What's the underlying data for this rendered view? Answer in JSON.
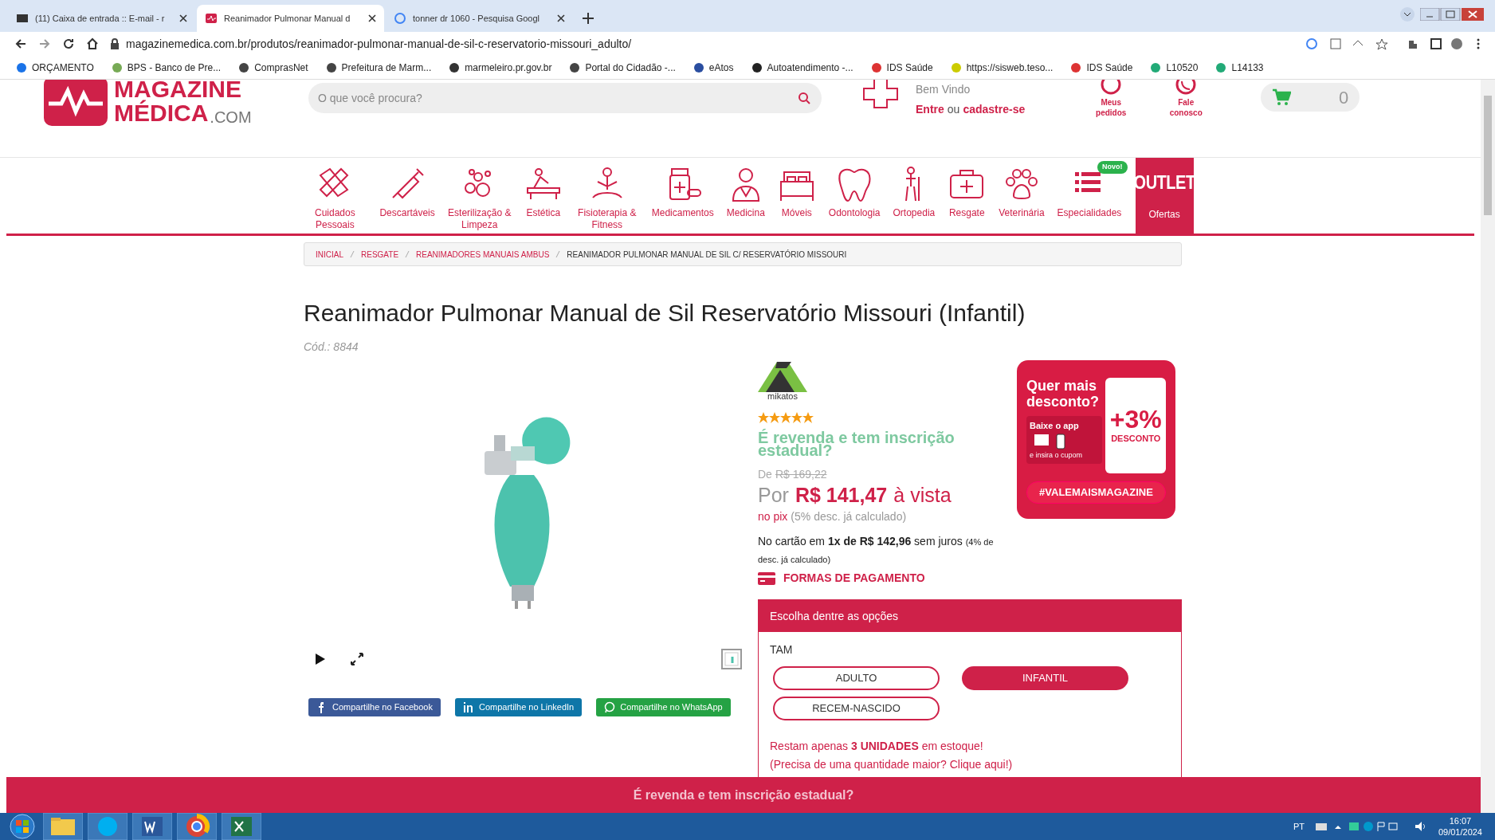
{
  "browser": {
    "tabs": [
      {
        "label": "(11) Caixa de entrada :: E-mail - r",
        "selected": false
      },
      {
        "label": "Reanimador Pulmonar Manual d",
        "selected": true
      },
      {
        "label": "tonner dr 1060 - Pesquisa Googl",
        "selected": false
      }
    ],
    "url": "magazinemedica.com.br/produtos/reanimador-pulmonar-manual-de-sil-c-reservatorio-missouri_adulto/",
    "bookmarks": [
      "ORÇAMENTO",
      "BPS - Banco de Pre...",
      "ComprasNet",
      "Prefeitura de Marm...",
      "marmeleiro.pr.gov.br",
      "Portal do Cidadão -...",
      "eAtos",
      "Autoatendimento -...",
      "IDS Saúde",
      "https://sisweb.teso...",
      "IDS Saúde",
      "L10520",
      "L14133"
    ]
  },
  "header": {
    "logo": {
      "line_1": "MAGAZINE",
      "line_2": "MÉDICA",
      "suffix": ".COM"
    },
    "search": {
      "placeholder": "O que você procura?"
    },
    "account": {
      "greeting": "Bem Vindo",
      "login": "Entre",
      "or": "ou",
      "register": "cadastre-se"
    },
    "links": [
      "Meus pedidos",
      "Fale conosco"
    ],
    "cart_count": "0"
  },
  "categories": [
    {
      "label": "Cuidados Pessoais"
    },
    {
      "label": "Descartáveis"
    },
    {
      "label": "Esterilização & Limpeza"
    },
    {
      "label": "Estética"
    },
    {
      "label": "Fisioterapia & Fitness"
    },
    {
      "label": "Medicamentos"
    },
    {
      "label": "Medicina"
    },
    {
      "label": "Móveis"
    },
    {
      "label": "Odontologia"
    },
    {
      "label": "Ortopedia"
    },
    {
      "label": "Resgate"
    },
    {
      "label": "Veterinária"
    },
    {
      "label": "Especialidades",
      "badge": "Novo!"
    }
  ],
  "outlet": {
    "title": "OUTLET",
    "label": "Ofertas"
  },
  "breadcrumb": [
    "INICIAL",
    "RESGATE",
    "REANIMADORES MANUAIS AMBUS",
    "REANIMADOR PULMONAR MANUAL DE SIL C/ RESERVATÓRIO MISSOURI"
  ],
  "product": {
    "title": "Reanimador Pulmonar Manual de Sil Reservatório Missouri (Infantil)",
    "code": "Cód.: 8844",
    "share": [
      "Compartilhe no Facebook",
      "Compartilhe no LinkedIn",
      "Compartilhe no WhatsApp"
    ],
    "brand": "mikatos",
    "stars": 5,
    "reseller_question": "É revenda e tem inscrição estadual?",
    "old_price_label": "De",
    "old_price": "R$ 169,22",
    "price_prefix": "Por",
    "price": "R$ 141,47",
    "price_suffix": "à vista",
    "pix": "no pix",
    "pix_note": "(5% desc. já calculado)",
    "card": "No cartão em **1x de R$ 142,96** sem juros",
    "card_note": "(4% de desc. já calculado)",
    "payment_link": "FORMAS DE PAGAMENTO"
  },
  "banner": {
    "title": "Quer mais desconto?",
    "app": "Baixe o app",
    "coupon": "e insira o cupom",
    "discount": "+3%",
    "discount_label": "DESCONTO",
    "hashtag": "#VALEMAISMAGAZINE"
  },
  "options": {
    "title": "Escolha dentre as opções",
    "label": "TAM",
    "choices": [
      {
        "label": "ADULTO",
        "selected": false
      },
      {
        "label": "INFANTIL",
        "selected": true
      },
      {
        "label": "RECEM-NASCIDO",
        "selected": false
      }
    ],
    "stock": "Restam apenas **3 UNIDADES** em estoque!",
    "more": "(Precisa de uma quantidade maior? Clique aqui!)"
  },
  "footer_bar": "É revenda e tem inscrição estadual?",
  "taskbar": {
    "language": "PT",
    "time": "16:07",
    "date": "09/01/2024"
  }
}
